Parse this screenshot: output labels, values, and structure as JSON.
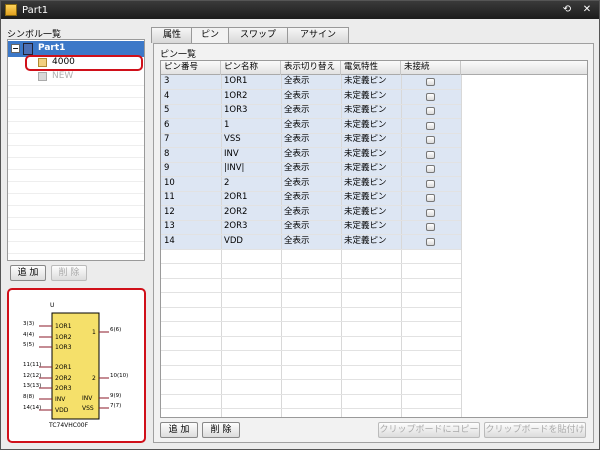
{
  "window": {
    "title": "Part1"
  },
  "left": {
    "symbol_list_label": "シンボル一覧",
    "tree": {
      "root": "Part1",
      "child1": "4000",
      "child2": "NEW"
    },
    "add_button": "追 加",
    "delete_button": "削 除"
  },
  "preview": {
    "ref": "U",
    "part_name": "TC74VHC00F",
    "left_pins": [
      {
        "num": "3(3)",
        "label": "1OR1"
      },
      {
        "num": "4(4)",
        "label": "1OR2"
      },
      {
        "num": "5(5)",
        "label": "1OR3"
      },
      {
        "num": "11(11)",
        "label": "2OR1"
      },
      {
        "num": "12(12)",
        "label": "2OR2"
      },
      {
        "num": "13(13)",
        "label": "2OR3"
      },
      {
        "num": "8(8)",
        "label": "INV"
      },
      {
        "num": "14(14)",
        "label": "VDD"
      }
    ],
    "right_pins": [
      {
        "num": "6(6)",
        "label": "1"
      },
      {
        "num": "10(10)",
        "label": "2"
      },
      {
        "num": "9(9)",
        "label": "INV"
      },
      {
        "num": "7(7)",
        "label": "VSS"
      }
    ]
  },
  "tabs": [
    "属性",
    "ピン",
    "スワップ",
    "アサイン"
  ],
  "pin_panel": {
    "label": "ピン一覧",
    "columns": [
      "ピン番号",
      "ピン名称",
      "表示切り替え",
      "電気特性",
      "未接続"
    ],
    "rows": [
      [
        "3",
        "1OR1",
        "全表示",
        "未定義ピン"
      ],
      [
        "4",
        "1OR2",
        "全表示",
        "未定義ピン"
      ],
      [
        "5",
        "1OR3",
        "全表示",
        "未定義ピン"
      ],
      [
        "6",
        "1",
        "全表示",
        "未定義ピン"
      ],
      [
        "7",
        "VSS",
        "全表示",
        "未定義ピン"
      ],
      [
        "8",
        "INV",
        "全表示",
        "未定義ピン"
      ],
      [
        "9",
        "|INV|",
        "全表示",
        "未定義ピン"
      ],
      [
        "10",
        "2",
        "全表示",
        "未定義ピン"
      ],
      [
        "11",
        "2OR1",
        "全表示",
        "未定義ピン"
      ],
      [
        "12",
        "2OR2",
        "全表示",
        "未定義ピン"
      ],
      [
        "13",
        "2OR3",
        "全表示",
        "未定義ピン"
      ],
      [
        "14",
        "VDD",
        "全表示",
        "未定義ピン"
      ]
    ],
    "add_button": "追 加",
    "delete_button": "削 除",
    "copy_button": "クリップボードにコピー",
    "paste_button": "クリップボードを貼付け"
  },
  "colors": {
    "selection": "#3c78c8",
    "highlight": "#d0101a",
    "row_fill": "#dde6f3",
    "chip_fill": "#f5e06a",
    "pin_line": "#8b1a2a"
  }
}
